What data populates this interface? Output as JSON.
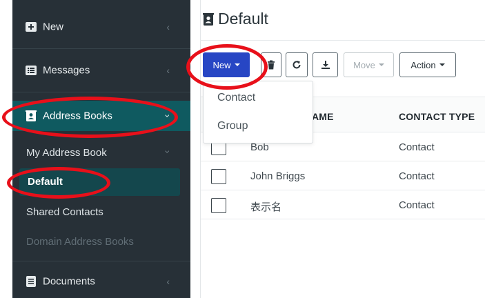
{
  "sidebar": {
    "items": [
      {
        "label": "New",
        "icon": "plus-square-icon"
      },
      {
        "label": "Messages",
        "icon": "list-icon"
      },
      {
        "label": "Address Books",
        "icon": "contact-book-icon"
      },
      {
        "label": "Documents",
        "icon": "document-icon"
      }
    ],
    "sub_items": {
      "my_address_book": "My Address Book",
      "default": "Default",
      "shared_contacts": "Shared Contacts",
      "domain_address_books": "Domain Address Books"
    }
  },
  "page": {
    "title": "Default"
  },
  "toolbar": {
    "new_label": "New",
    "move_label": "Move",
    "action_label": "Action"
  },
  "dropdown": {
    "items": [
      "Contact",
      "Group"
    ]
  },
  "table": {
    "headers": [
      "AME",
      "CONTACT TYPE"
    ],
    "rows": [
      {
        "name": "Bob",
        "type": "Contact"
      },
      {
        "name": "John Briggs",
        "type": "Contact"
      },
      {
        "name": "表示名",
        "type": "Contact"
      }
    ]
  },
  "colors": {
    "sidebar_bg": "#273037",
    "active_bg": "#0f5a60",
    "primary_button": "#2746c4",
    "annotation": "#e8101a"
  }
}
